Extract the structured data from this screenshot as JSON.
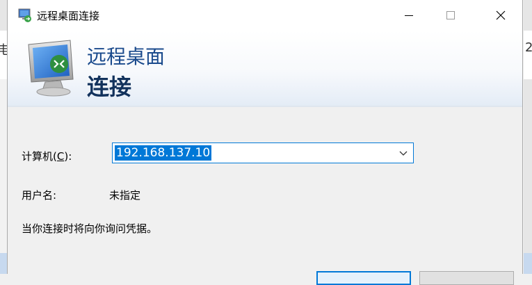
{
  "window": {
    "title": "远程桌面连接",
    "icon": "remote-desktop-icon",
    "controls": [
      "minimize-icon",
      "maximize-icon",
      "close-icon"
    ]
  },
  "banner": {
    "line1": "远程桌面",
    "line2": "连接",
    "icon": "remote-desktop-monitor-icon"
  },
  "form": {
    "computer_label_prefix": "计算机(",
    "computer_label_key": "C",
    "computer_label_suffix": "):",
    "computer_value": "192.168.137.10",
    "username_label": "用户名:",
    "username_value": "未指定",
    "info_text": "当你连接时将向你询问凭据。"
  },
  "colors": {
    "accent": "#0078d7",
    "banner_text": "#1a4a8c",
    "banner_bold": "#12325c"
  },
  "background": {
    "left_glyph": "电",
    "right_glyph": "2"
  }
}
